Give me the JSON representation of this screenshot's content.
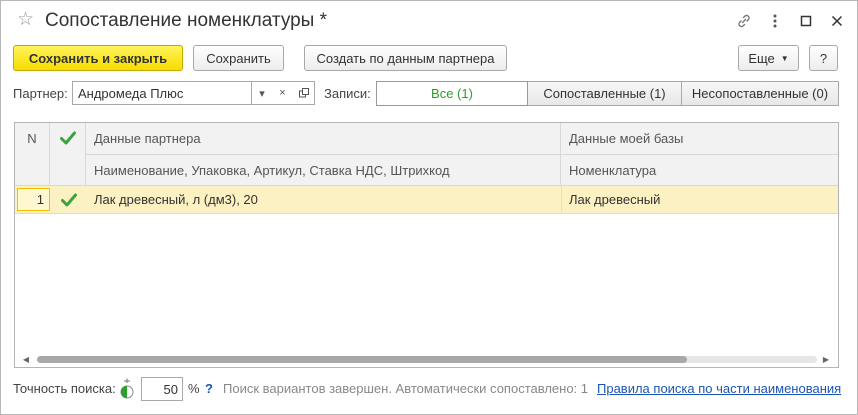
{
  "window": {
    "title": "Сопоставление номенклатуры *",
    "icons": [
      "star-icon",
      "link-icon",
      "more-vertical-icon",
      "maximize-icon",
      "close-icon"
    ]
  },
  "toolbar": {
    "save_close_label": "Сохранить и закрыть",
    "save_label": "Сохранить",
    "create_label": "Создать по данным партнера",
    "more_label": "Еще",
    "help_label": "?"
  },
  "filter": {
    "partner_label": "Партнер:",
    "partner_value": "Андромеда Плюс",
    "records_label": "Записи:",
    "segments": [
      {
        "label": "Все (1)",
        "active": true
      },
      {
        "label": "Сопоставленные (1)",
        "active": false
      },
      {
        "label": "Несопоставленные (0)",
        "active": false
      }
    ]
  },
  "table": {
    "col_n": "N",
    "col_partner_group": "Данные партнера",
    "col_partner_sub": "Наименование, Упаковка, Артикул, Ставка НДС, Штрихкод",
    "col_base_group": "Данные моей базы",
    "col_base_sub": "Номенклатура",
    "rows": [
      {
        "n": "1",
        "partner_data": "Лак древесный, л (дм3), 20",
        "base_data": "Лак древесный"
      }
    ]
  },
  "footer": {
    "accuracy_label": "Точность поиска:",
    "accuracy_value": "50",
    "percent_sign": "%",
    "help_mark": "?",
    "status_text": "Поиск вариантов завершен. Автоматически сопоставлено: 1",
    "rules_link": "Правила поиска по части наименования"
  },
  "colors": {
    "primary_button": "#f6dd00",
    "active_segment_text": "#2aa12a",
    "selected_row": "#fbf1c2",
    "check_icon": "#3ca33c",
    "link": "#1b55b5"
  }
}
